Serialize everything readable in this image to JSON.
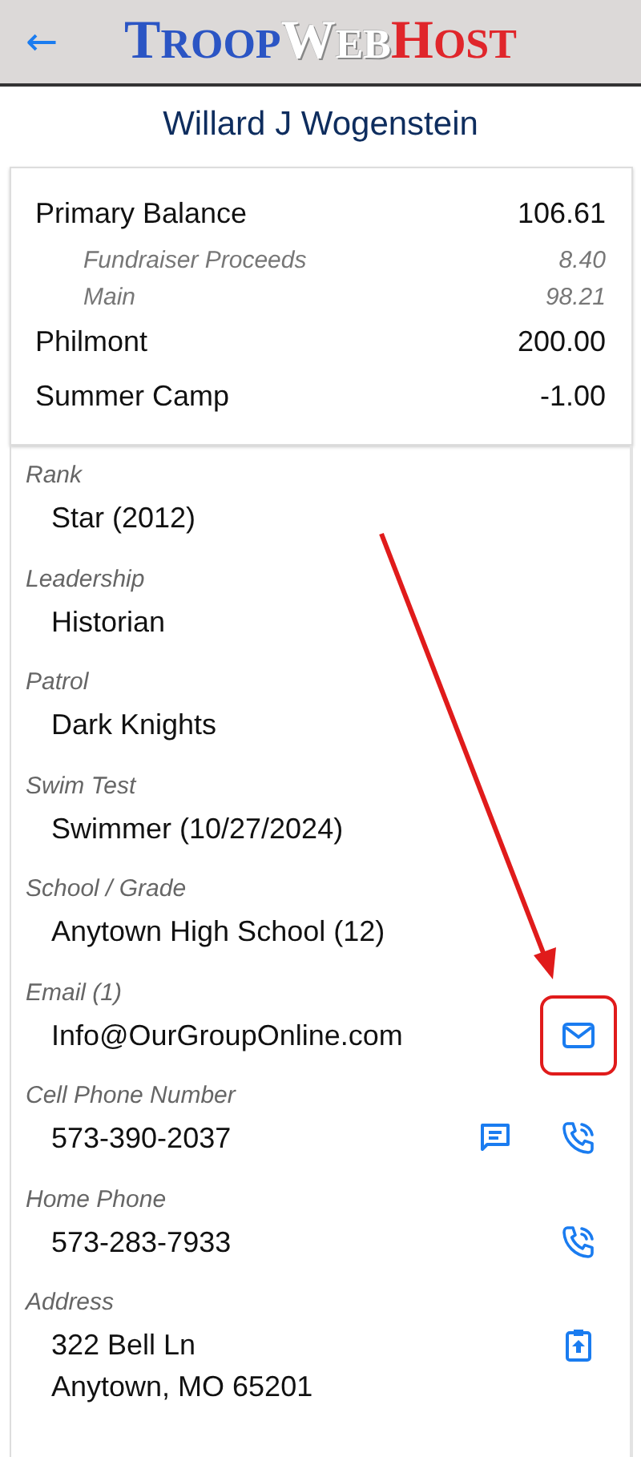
{
  "header": {
    "back_icon": "←",
    "logo": [
      {
        "text": "TROOP",
        "color": "#2b55c4"
      },
      {
        "text": "WEB",
        "color": "#ffffff"
      },
      {
        "text": "HOST",
        "color": "#e0262b"
      }
    ]
  },
  "member_name": "Willard J Wogenstein",
  "balances": [
    {
      "label": "Primary Balance",
      "amount": "106.61",
      "kind": "main"
    },
    {
      "label": "Fundraiser Proceeds",
      "amount": "8.40",
      "kind": "sub"
    },
    {
      "label": "Main",
      "amount": "98.21",
      "kind": "sub"
    },
    {
      "label": "Philmont",
      "amount": "200.00",
      "kind": "main"
    },
    {
      "label": "Summer Camp",
      "amount": "-1.00",
      "kind": "main"
    }
  ],
  "fields": [
    {
      "label": "Rank",
      "lines": [
        "Star (2012)"
      ]
    },
    {
      "label": "Leadership",
      "lines": [
        "Historian"
      ]
    },
    {
      "label": "Patrol",
      "lines": [
        "Dark Knights"
      ]
    },
    {
      "label": "Swim Test",
      "lines": [
        "Swimmer (10/27/2024)"
      ]
    },
    {
      "label": "School / Grade",
      "lines": [
        "Anytown High School (12)"
      ]
    },
    {
      "label": "Email (1)",
      "lines": [
        "Info@OurGroupOnline.com"
      ],
      "actions": [
        {
          "kind": "email",
          "highlighted": true
        }
      ]
    },
    {
      "label": "Cell Phone Number",
      "lines": [
        "573-390-2037"
      ],
      "actions": [
        {
          "kind": "message",
          "highlighted": false
        },
        {
          "kind": "call",
          "highlighted": false
        }
      ]
    },
    {
      "label": "Home Phone",
      "lines": [
        "573-283-7933"
      ],
      "actions": [
        {
          "kind": "call",
          "highlighted": false
        }
      ]
    },
    {
      "label": "Address",
      "lines": [
        "322 Bell Ln",
        "Anytown, MO  65201"
      ],
      "actions": [
        {
          "kind": "map",
          "highlighted": false
        }
      ]
    }
  ],
  "annotations": [
    {
      "kind": "arrow"
    }
  ]
}
